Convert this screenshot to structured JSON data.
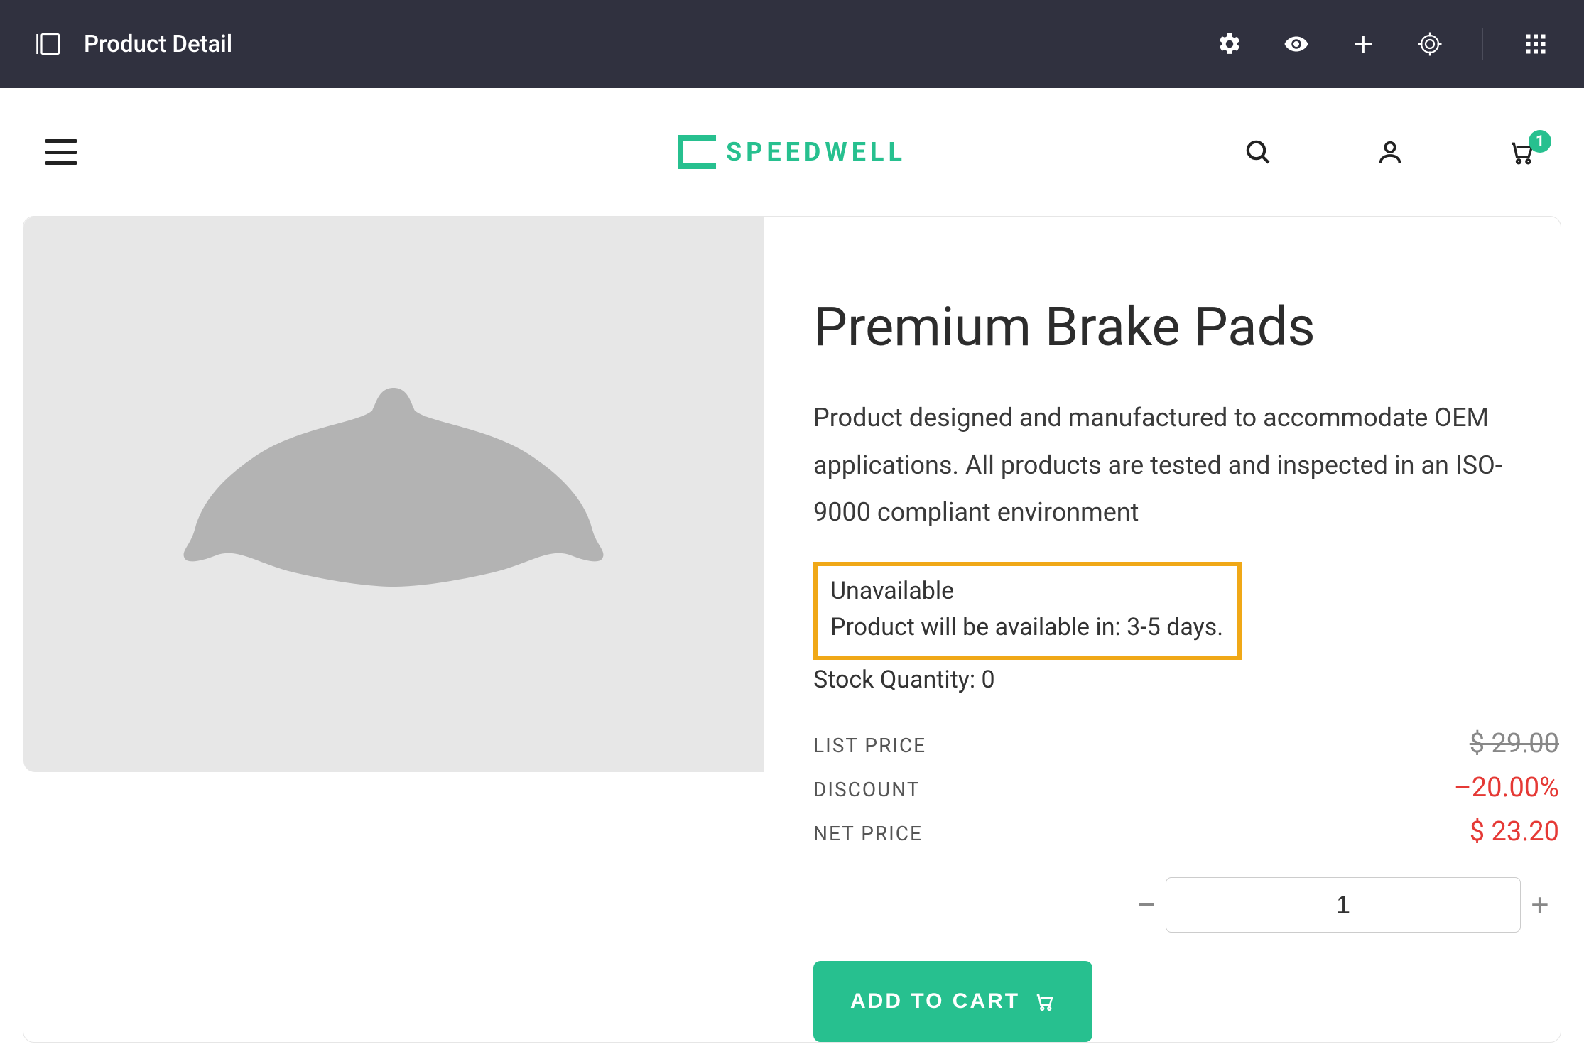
{
  "admin": {
    "title": "Product Detail"
  },
  "site": {
    "brand_name": "SPEEDWELL",
    "cart_count": "1"
  },
  "product": {
    "title": "Premium Brake Pads",
    "description": "Product designed and manufactured to accommodate OEM applications. All products are tested and inspected in an ISO-9000 compliant environment",
    "availability_status": "Unavailable",
    "availability_eta": "Product will be available in: 3-5 days.",
    "stock_line": "Stock Quantity: 0",
    "list_price_label": "LIST PRICE",
    "list_price_value": "$ 29.00",
    "discount_label": "DISCOUNT",
    "discount_value": "–20.00%",
    "net_price_label": "NET PRICE",
    "net_price_value": "$ 23.20",
    "quantity": "1",
    "add_to_cart_label": "ADD TO CART"
  }
}
